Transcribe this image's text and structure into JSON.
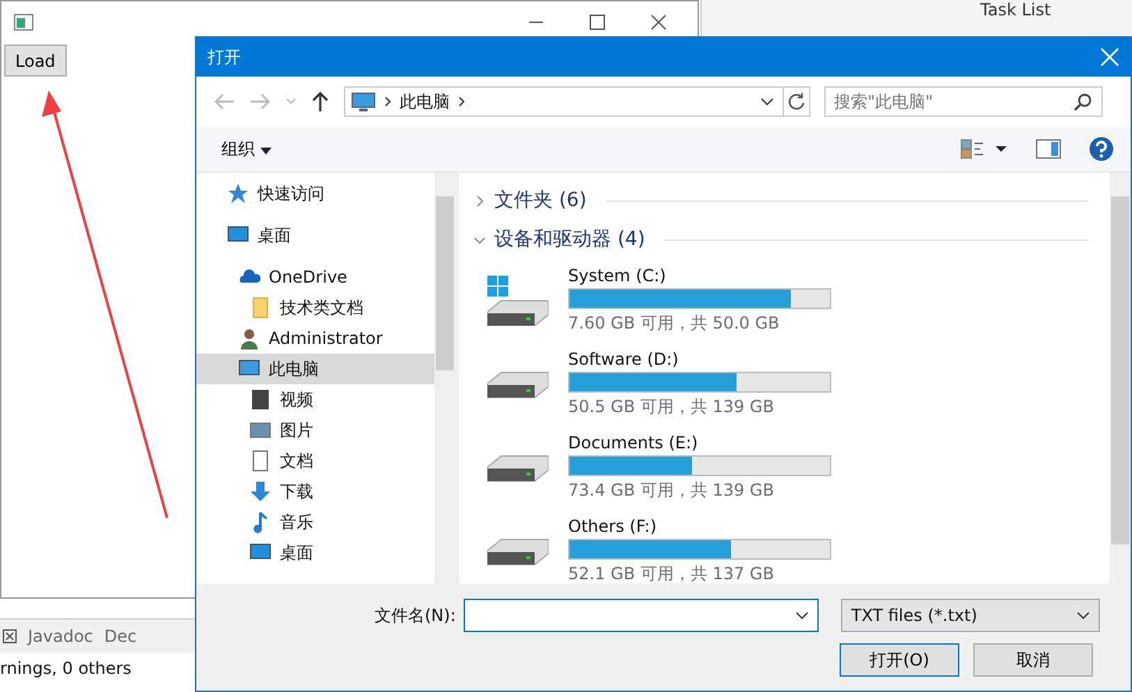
{
  "ide": {
    "top_tab": "Task List",
    "bottom_tabs": [
      {
        "label": "Javadoc"
      },
      {
        "label": "Dec"
      }
    ],
    "status": "rnings, 0 others"
  },
  "app_window": {
    "button": "Load"
  },
  "dialog": {
    "title": "打开",
    "address": "此电脑",
    "search": {
      "placeholder": "搜索\"此电脑\""
    },
    "organize": "组织",
    "nav": [
      {
        "label": "快速访问",
        "kind": "star",
        "selected": false
      },
      {
        "label": "桌面",
        "kind": "desktop",
        "selected": false,
        "children": [
          {
            "label": "OneDrive",
            "kind": "cloud",
            "selected": false,
            "children": [
              {
                "label": "技术类文档",
                "kind": "folder",
                "selected": false
              }
            ]
          },
          {
            "label": "Administrator",
            "kind": "person",
            "selected": false
          },
          {
            "label": "此电脑",
            "kind": "computer",
            "selected": true,
            "children": [
              {
                "label": "视频",
                "kind": "video",
                "selected": false
              },
              {
                "label": "图片",
                "kind": "picture",
                "selected": false
              },
              {
                "label": "文档",
                "kind": "document",
                "selected": false
              },
              {
                "label": "下载",
                "kind": "download",
                "selected": false
              },
              {
                "label": "音乐",
                "kind": "music",
                "selected": false
              },
              {
                "label": "桌面",
                "kind": "desktop",
                "selected": false
              }
            ]
          }
        ]
      }
    ],
    "groups": [
      {
        "label": "文件夹 (6)",
        "expanded": false
      },
      {
        "label": "设备和驱动器 (4)",
        "expanded": true,
        "drives": [
          {
            "name": "System (C:)",
            "kind": "system",
            "level": 0.85,
            "reading": "7.60 GB 可用，共 50.0 GB"
          },
          {
            "name": "Software (D:)",
            "kind": "disk",
            "level": 0.64,
            "reading": "50.5 GB 可用，共 139 GB"
          },
          {
            "name": "Documents (E:)",
            "kind": "disk",
            "level": 0.47,
            "reading": "73.4 GB 可用，共 139 GB"
          },
          {
            "name": "Others (F:)",
            "kind": "disk",
            "level": 0.62,
            "reading": "52.1 GB 可用，共 137 GB"
          }
        ]
      }
    ],
    "file_name_label": "文件名(N):",
    "filter": "TXT files (*.txt)",
    "buttons": [
      "打开(O)",
      "取消"
    ]
  }
}
